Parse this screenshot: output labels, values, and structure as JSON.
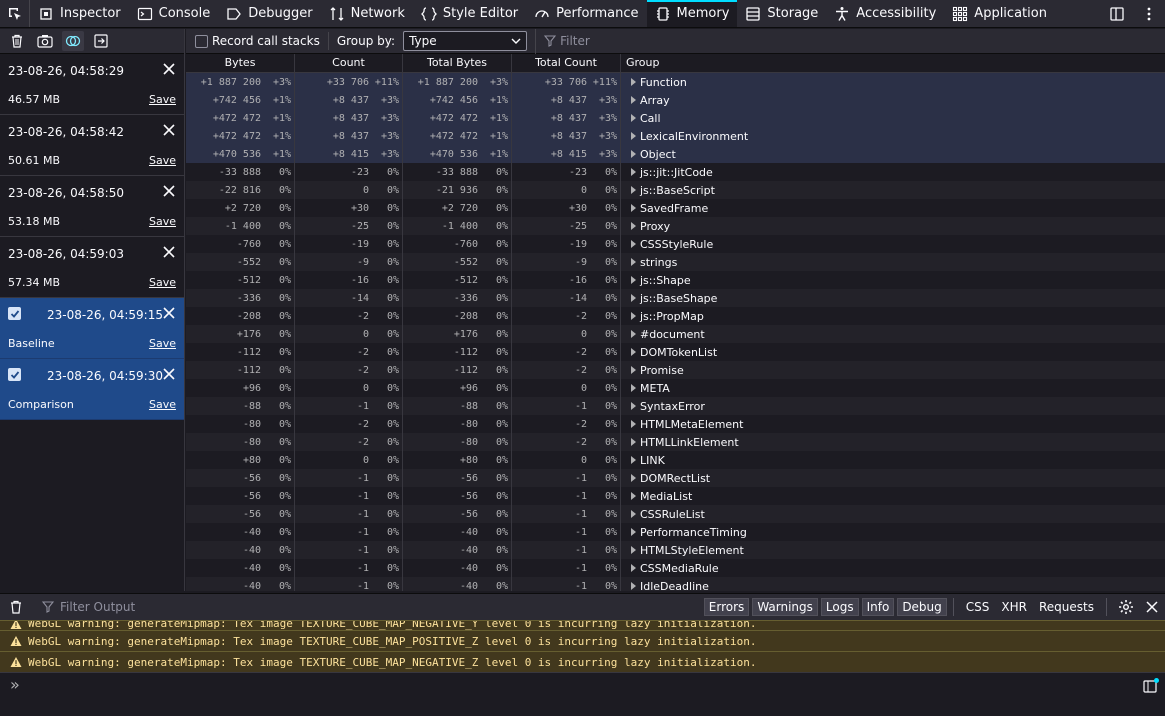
{
  "toolbar": {
    "tabs": [
      {
        "label": "Inspector",
        "icon": "inspector-icon"
      },
      {
        "label": "Console",
        "icon": "console-icon"
      },
      {
        "label": "Debugger",
        "icon": "debugger-icon"
      },
      {
        "label": "Network",
        "icon": "network-icon"
      },
      {
        "label": "Style Editor",
        "icon": "style-editor-icon"
      },
      {
        "label": "Performance",
        "icon": "performance-icon"
      },
      {
        "label": "Memory",
        "icon": "memory-icon"
      },
      {
        "label": "Storage",
        "icon": "storage-icon"
      },
      {
        "label": "Accessibility",
        "icon": "accessibility-icon"
      },
      {
        "label": "Application",
        "icon": "application-icon"
      }
    ],
    "selected_tab": "Memory"
  },
  "snapshots": [
    {
      "title": "23-08-26, 04:58:29",
      "size": "46.57 MB",
      "save": "Save",
      "selected": false
    },
    {
      "title": "23-08-26, 04:58:42",
      "size": "50.61 MB",
      "save": "Save",
      "selected": false
    },
    {
      "title": "23-08-26, 04:58:50",
      "size": "53.18 MB",
      "save": "Save",
      "selected": false
    },
    {
      "title": "23-08-26, 04:59:03",
      "size": "57.34 MB",
      "save": "Save",
      "selected": false
    },
    {
      "title": "23-08-26, 04:59:15",
      "size": "Baseline",
      "save": "Save",
      "selected": true
    },
    {
      "title": "23-08-26, 04:59:30",
      "size": "Comparison",
      "save": "Save",
      "selected": true
    }
  ],
  "main_toolbar": {
    "record_call_stacks": "Record call stacks",
    "group_by_label": "Group by:",
    "group_by_value": "Type",
    "filter_placeholder": "Filter"
  },
  "columns": [
    "Bytes",
    "Count",
    "Total Bytes",
    "Total Count",
    "Group"
  ],
  "rows": [
    [
      "+1 887 200",
      "+3%",
      "+33 706",
      "+11%",
      "+1 887 200",
      "+3%",
      "+33 706",
      "+11%",
      "Function"
    ],
    [
      "+742 456",
      "+1%",
      "+8 437",
      "+3%",
      "+742 456",
      "+1%",
      "+8 437",
      "+3%",
      "Array"
    ],
    [
      "+472 472",
      "+1%",
      "+8 437",
      "+3%",
      "+472 472",
      "+1%",
      "+8 437",
      "+3%",
      "Call"
    ],
    [
      "+472 472",
      "+1%",
      "+8 437",
      "+3%",
      "+472 472",
      "+1%",
      "+8 437",
      "+3%",
      "LexicalEnvironment"
    ],
    [
      "+470 536",
      "+1%",
      "+8 415",
      "+3%",
      "+470 536",
      "+1%",
      "+8 415",
      "+3%",
      "Object"
    ],
    [
      "-33 888",
      "0%",
      "-23",
      "0%",
      "-33 888",
      "0%",
      "-23",
      "0%",
      "js::jit::JitCode"
    ],
    [
      "-22 816",
      "0%",
      "0",
      "0%",
      "-21 936",
      "0%",
      "0",
      "0%",
      "js::BaseScript"
    ],
    [
      "+2 720",
      "0%",
      "+30",
      "0%",
      "+2 720",
      "0%",
      "+30",
      "0%",
      "SavedFrame"
    ],
    [
      "-1 400",
      "0%",
      "-25",
      "0%",
      "-1 400",
      "0%",
      "-25",
      "0%",
      "Proxy"
    ],
    [
      "-760",
      "0%",
      "-19",
      "0%",
      "-760",
      "0%",
      "-19",
      "0%",
      "CSSStyleRule"
    ],
    [
      "-552",
      "0%",
      "-9",
      "0%",
      "-552",
      "0%",
      "-9",
      "0%",
      "strings"
    ],
    [
      "-512",
      "0%",
      "-16",
      "0%",
      "-512",
      "0%",
      "-16",
      "0%",
      "js::Shape"
    ],
    [
      "-336",
      "0%",
      "-14",
      "0%",
      "-336",
      "0%",
      "-14",
      "0%",
      "js::BaseShape"
    ],
    [
      "-208",
      "0%",
      "-2",
      "0%",
      "-208",
      "0%",
      "-2",
      "0%",
      "js::PropMap"
    ],
    [
      "+176",
      "0%",
      "0",
      "0%",
      "+176",
      "0%",
      "0",
      "0%",
      "#document"
    ],
    [
      "-112",
      "0%",
      "-2",
      "0%",
      "-112",
      "0%",
      "-2",
      "0%",
      "DOMTokenList"
    ],
    [
      "-112",
      "0%",
      "-2",
      "0%",
      "-112",
      "0%",
      "-2",
      "0%",
      "Promise"
    ],
    [
      "+96",
      "0%",
      "0",
      "0%",
      "+96",
      "0%",
      "0",
      "0%",
      "META"
    ],
    [
      "-88",
      "0%",
      "-1",
      "0%",
      "-88",
      "0%",
      "-1",
      "0%",
      "SyntaxError"
    ],
    [
      "-80",
      "0%",
      "-2",
      "0%",
      "-80",
      "0%",
      "-2",
      "0%",
      "HTMLMetaElement"
    ],
    [
      "-80",
      "0%",
      "-2",
      "0%",
      "-80",
      "0%",
      "-2",
      "0%",
      "HTMLLinkElement"
    ],
    [
      "+80",
      "0%",
      "0",
      "0%",
      "+80",
      "0%",
      "0",
      "0%",
      "LINK"
    ],
    [
      "-56",
      "0%",
      "-1",
      "0%",
      "-56",
      "0%",
      "-1",
      "0%",
      "DOMRectList"
    ],
    [
      "-56",
      "0%",
      "-1",
      "0%",
      "-56",
      "0%",
      "-1",
      "0%",
      "MediaList"
    ],
    [
      "-56",
      "0%",
      "-1",
      "0%",
      "-56",
      "0%",
      "-1",
      "0%",
      "CSSRuleList"
    ],
    [
      "-40",
      "0%",
      "-1",
      "0%",
      "-40",
      "0%",
      "-1",
      "0%",
      "PerformanceTiming"
    ],
    [
      "-40",
      "0%",
      "-1",
      "0%",
      "-40",
      "0%",
      "-1",
      "0%",
      "HTMLStyleElement"
    ],
    [
      "-40",
      "0%",
      "-1",
      "0%",
      "-40",
      "0%",
      "-1",
      "0%",
      "CSSMediaRule"
    ],
    [
      "-40",
      "0%",
      "-1",
      "0%",
      "-40",
      "0%",
      "-1",
      "0%",
      "IdleDeadline"
    ]
  ],
  "console": {
    "filter_placeholder": "Filter Output",
    "level_chips": [
      "Errors",
      "Warnings",
      "Logs",
      "Info",
      "Debug"
    ],
    "type_chips": [
      "CSS",
      "XHR",
      "Requests"
    ],
    "messages": [
      "WebGL warning: generateMipmap: Tex image TEXTURE_CUBE_MAP_NEGATIVE_Y level 0 is incurring lazy initialization.",
      "WebGL warning: generateMipmap: Tex image TEXTURE_CUBE_MAP_POSITIVE_Z level 0 is incurring lazy initialization.",
      "WebGL warning: generateMipmap: Tex image TEXTURE_CUBE_MAP_NEGATIVE_Z level 0 is incurring lazy initialization."
    ],
    "prompt": "»"
  },
  "colors": {
    "accent": "#00ddff",
    "selected_snapshot": "#1f4a8a",
    "warning_bg": "#42381d",
    "warning_text": "#fce19b"
  }
}
